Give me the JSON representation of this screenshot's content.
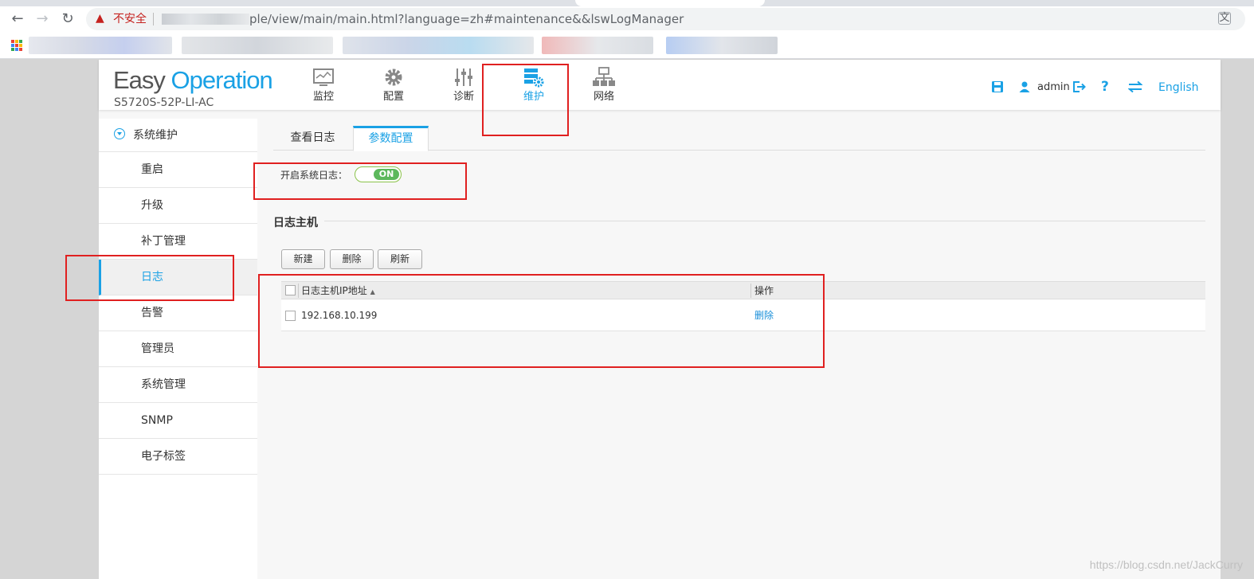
{
  "browser": {
    "insecure_label": "不安全",
    "url": "ple/view/main/main.html?language=zh#maintenance&&lswLogManager"
  },
  "header": {
    "logo_easy": "Easy",
    "logo_operation": "Operation",
    "device_model": "S5720S-52P-LI-AC",
    "nav": [
      {
        "label": "监控",
        "icon": "monitor-icon"
      },
      {
        "label": "配置",
        "icon": "gear-icon"
      },
      {
        "label": "诊断",
        "icon": "sliders-icon"
      },
      {
        "label": "维护",
        "icon": "maintenance-icon"
      },
      {
        "label": "网络",
        "icon": "network-topology-icon"
      }
    ],
    "active_nav": "维护",
    "user": "admin",
    "help": "?",
    "language": "English"
  },
  "sidebar": {
    "group_title": "系统维护",
    "items": [
      {
        "label": "重启"
      },
      {
        "label": "升级"
      },
      {
        "label": "补丁管理"
      },
      {
        "label": "日志"
      },
      {
        "label": "告警"
      },
      {
        "label": "管理员"
      },
      {
        "label": "系统管理"
      },
      {
        "label": "SNMP"
      },
      {
        "label": "电子标签"
      }
    ],
    "active_item": "日志"
  },
  "content": {
    "tabs": [
      {
        "label": "查看日志"
      },
      {
        "label": "参数配置"
      }
    ],
    "active_tab": "参数配置",
    "syslog_label": "开启系统日志：",
    "syslog_toggle": "ON",
    "section_title": "日志主机",
    "buttons": {
      "new": "新建",
      "delete": "删除",
      "refresh": "刷新"
    },
    "table": {
      "columns": [
        "日志主机IP地址",
        "操作"
      ],
      "sort_indicator": "▲",
      "rows": [
        {
          "ip": "192.168.10.199",
          "action": "删除"
        }
      ]
    }
  },
  "watermark": "https://blog.csdn.net/JackCurry",
  "colors": {
    "accent": "#1aa1e5",
    "toggle_on": "#5cb85c",
    "highlight_box": "#e02020"
  }
}
